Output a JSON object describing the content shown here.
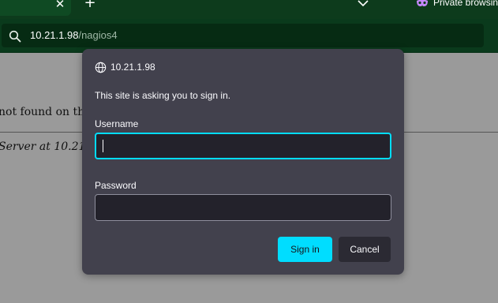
{
  "browser": {
    "tab": {
      "close_glyph": "✕"
    },
    "new_tab_glyph": "+",
    "private_label": "Private browsin",
    "url": {
      "host": "10.21.1.98",
      "path": "/nagios4"
    }
  },
  "page": {
    "text_1": "not found on this",
    "text_2": "Server at 10.21.1"
  },
  "dialog": {
    "host": "10.21.1.98",
    "message": "This site is asking you to sign in.",
    "username_label": "Username",
    "username_value": "",
    "password_label": "Password",
    "password_value": "",
    "signin_label": "Sign in",
    "cancel_label": "Cancel"
  },
  "colors": {
    "chrome_bg": "#0a3a1c",
    "dialog_bg": "#42414d",
    "accent": "#00ddff",
    "input_bg": "#23222b"
  },
  "icons": [
    "close-icon",
    "plus-icon",
    "chevron-down-icon",
    "private-mask-icon",
    "search-icon",
    "globe-icon"
  ]
}
